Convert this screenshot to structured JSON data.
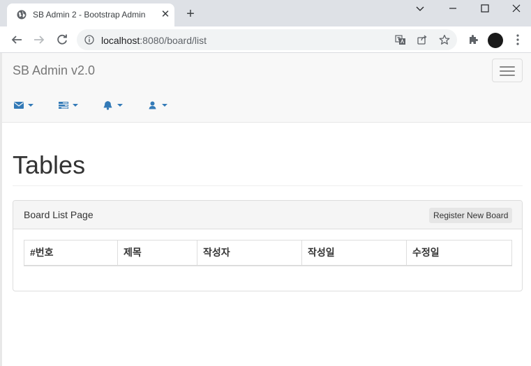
{
  "browser": {
    "tab_title": "SB Admin 2 - Bootstrap Admin",
    "url_host": "localhost",
    "url_rest": ":8080/board/list"
  },
  "navbar": {
    "brand": "SB Admin v2.0",
    "icons": [
      "envelope-icon",
      "tasks-icon",
      "bell-icon",
      "user-icon"
    ],
    "accent": "#337ab7"
  },
  "page": {
    "title": "Tables"
  },
  "panel": {
    "heading": "Board List Page",
    "register_button": "Register New Board",
    "columns": [
      "#번호",
      "제목",
      "작성자",
      "작성일",
      "수정일"
    ]
  }
}
